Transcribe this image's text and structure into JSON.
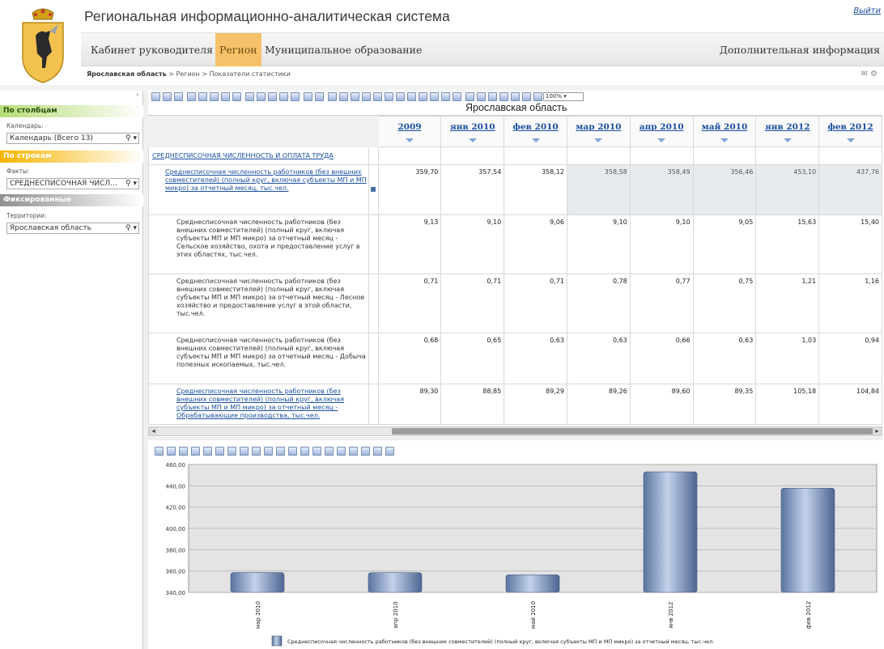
{
  "header": {
    "title": "Региональная информационно-аналитическая система",
    "logout": "Выйти",
    "nav": [
      "Кабинет руководителя",
      "Регион",
      "Муниципальное образование"
    ],
    "nav_right": "Дополнительная информация",
    "breadcrumb_bold": "Ярославская область",
    "breadcrumb_rest": " > Регион > Показатели статистики"
  },
  "left_panel": {
    "columns_header": "По столбцам",
    "calendar_label": "Календарь:",
    "calendar_value": "Календарь (Всего 13)",
    "rows_header": "По строкам",
    "facts_label": "Факты:",
    "facts_value": "СРЕДНЕСПИСОЧНАЯ ЧИСЛ...",
    "fixed_header": "Фиксированные",
    "territory_label": "Территории:",
    "territory_value": "Ярославская область"
  },
  "grid": {
    "title": "Ярославская область",
    "zoom": "100%",
    "columns": [
      "2009",
      "янв 2010",
      "фев 2010",
      "мар 2010",
      "апр 2010",
      "май 2010",
      "янв 2012",
      "фев 2012"
    ],
    "section_title": "СРЕДНЕСПИСОЧНАЯ ЧИСЛЕННОСТЬ И ОПЛАТА ТРУДА",
    "rows": [
      {
        "label": "Среднесписочная численность работников (без внешних совместителей) (полный круг, включая субъекты МП и МП микро) за отчетный месяц, тыс.чел.",
        "values": [
          "359,70",
          "357,54",
          "358,12",
          "358,58",
          "358,49",
          "356,46",
          "453,10",
          "437,76"
        ]
      },
      {
        "label": "Среднесписочная численность работников (без внешних совместителей) (полный круг, включая субъекты МП и МП микро) за отчетный месяц - Сельское хозяйство, охота и предоставление услуг в этих областях, тыс.чел.",
        "values": [
          "9,13",
          "9,10",
          "9,06",
          "9,10",
          "9,10",
          "9,05",
          "15,63",
          "15,40"
        ]
      },
      {
        "label": "Среднесписочная численность работников (без внешних совместителей) (полный круг, включая субъекты МП и МП микро) за отчетный месяц - Лесное хозяйство и предоставление услуг в этой области, тыс.чел.",
        "values": [
          "0,71",
          "0,71",
          "0,71",
          "0,78",
          "0,77",
          "0,75",
          "1,21",
          "1,16"
        ]
      },
      {
        "label": "Среднесписочная численность работников (без внешних совместителей) (полный круг, включая субъекты МП и МП микро) за отчетный месяц - Добыча полезных ископаемых, тыс.чел.",
        "values": [
          "0,68",
          "0,65",
          "0,63",
          "0,63",
          "0,66",
          "0,63",
          "1,03",
          "0,94"
        ]
      },
      {
        "label": "Среднесписочная численность работников (без внешних совместителей) (полный круг, включая субъекты МП и МП микро) за отчетный месяц - Обрабатывающие производства, тыс.чел.",
        "values": [
          "89,30",
          "88,85",
          "89,29",
          "89,26",
          "89,60",
          "89,35",
          "105,18",
          "104,84"
        ]
      }
    ]
  },
  "chart_data": {
    "type": "bar",
    "categories": [
      "мар 2010",
      "апр 2010",
      "май 2010",
      "янв 2012",
      "фев 2012"
    ],
    "values": [
      358.58,
      358.49,
      356.46,
      453.1,
      437.76
    ],
    "yticks": [
      "340,00",
      "360,00",
      "380,00",
      "400,00",
      "420,00",
      "440,00",
      "460,00"
    ],
    "ylim": [
      340,
      460
    ],
    "grid": true,
    "legend": "Среднесписочная численность работников (без внешних совместителей) (полный круг, включая субъекты МП и МП микро) за отчетный месяц, тыс.чел.",
    "legend_position": "bottom",
    "bar_color": "#7c93b8"
  }
}
